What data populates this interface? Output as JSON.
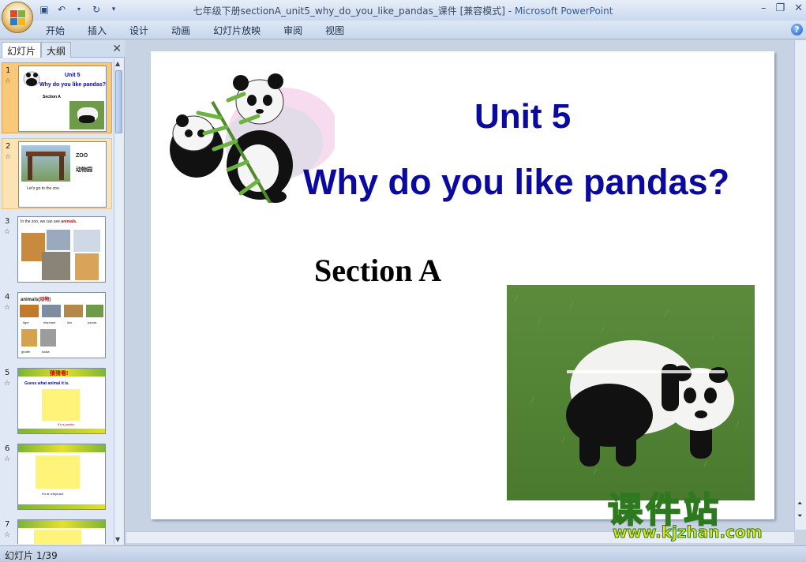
{
  "window": {
    "title": "七年级下册sectionA_unit5_why_do_you_like_pandas_课件 [兼容模式]",
    "title_sep": " - ",
    "app_name": "Microsoft PowerPoint"
  },
  "ribbon": {
    "tabs": [
      "开始",
      "插入",
      "设计",
      "动画",
      "幻灯片放映",
      "审阅",
      "视图"
    ]
  },
  "left_panel": {
    "tab_slides": "幻灯片",
    "tab_outline": "大纲",
    "thumbnails": [
      {
        "num": "1",
        "title": "Unit 5",
        "subtitle": "Why do you like pandas?",
        "section": "Section A"
      },
      {
        "num": "2",
        "label_a": "ZOO",
        "label_b": "动物园",
        "caption": "Let's go to the zoo."
      },
      {
        "num": "3",
        "caption_a": "In the zoo, we can see ",
        "caption_b": "animals."
      },
      {
        "num": "4",
        "caption_a": "animals(",
        "caption_b": "动物)",
        "labels": [
          "tiger",
          "elephant",
          "lion",
          "panda",
          "giraffe",
          "koala"
        ]
      },
      {
        "num": "5",
        "banner": "猜猜看!",
        "question": "Guess what animal it is.",
        "answer": "It's a panda."
      },
      {
        "num": "6",
        "answer": "It's an elephant."
      },
      {
        "num": "7"
      }
    ]
  },
  "slide": {
    "heading": "Unit 5",
    "subheading": "Why do you like pandas?",
    "section": "Section A"
  },
  "watermark": {
    "cn": "课件站",
    "url": "www.kjzhan.com"
  },
  "status": {
    "slide_counter": "幻灯片 1/39"
  },
  "colors": {
    "title_blue": "#0a0a9e",
    "selected_thumb": "#f7c979"
  }
}
